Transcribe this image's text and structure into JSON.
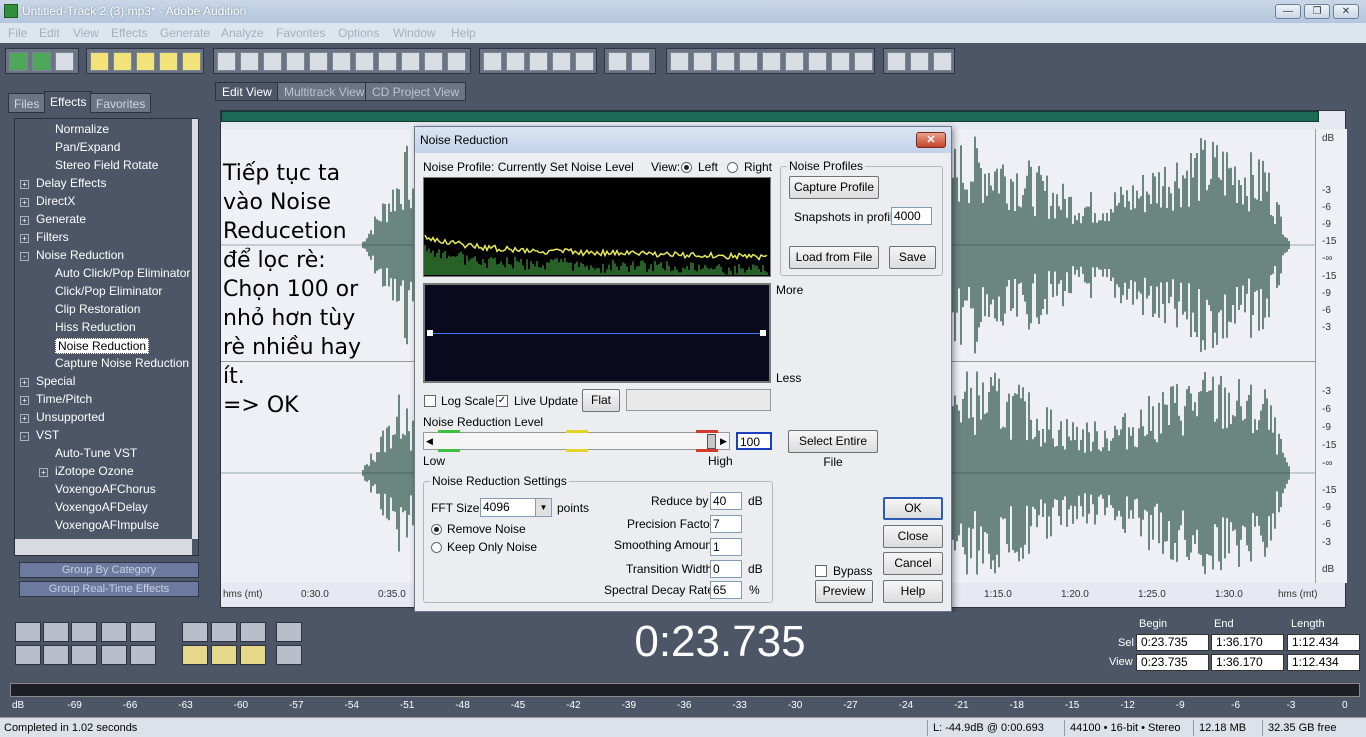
{
  "window": {
    "title": "Untitled-Track 2 (3).mp3* - Adobe Audition"
  },
  "menu": [
    "File",
    "Edit",
    "View",
    "Effects",
    "Generate",
    "Analyze",
    "Favorites",
    "Options",
    "Window",
    "Help"
  ],
  "left_panel": {
    "tabs": [
      "Files",
      "Effects",
      "Favorites"
    ],
    "tree": [
      {
        "label": "Normalize",
        "indent": 2
      },
      {
        "label": "Pan/Expand",
        "indent": 2
      },
      {
        "label": "Stereo Field Rotate",
        "indent": 2
      },
      {
        "label": "Delay Effects",
        "indent": 1,
        "toggle": "+"
      },
      {
        "label": "DirectX",
        "indent": 1,
        "toggle": "+"
      },
      {
        "label": "Generate",
        "indent": 1,
        "toggle": "+"
      },
      {
        "label": "Filters",
        "indent": 1,
        "toggle": "+"
      },
      {
        "label": "Noise Reduction",
        "indent": 1,
        "toggle": "-"
      },
      {
        "label": "Auto Click/Pop Eliminator",
        "indent": 2
      },
      {
        "label": "Click/Pop Eliminator",
        "indent": 2
      },
      {
        "label": "Clip Restoration",
        "indent": 2
      },
      {
        "label": "Hiss Reduction",
        "indent": 2
      },
      {
        "label": "Noise Reduction",
        "indent": 2,
        "selected": true
      },
      {
        "label": "Capture Noise Reduction Profile",
        "indent": 2
      },
      {
        "label": "Special",
        "indent": 1,
        "toggle": "+"
      },
      {
        "label": "Time/Pitch",
        "indent": 1,
        "toggle": "+"
      },
      {
        "label": "Unsupported",
        "indent": 1,
        "toggle": "+"
      },
      {
        "label": "VST",
        "indent": 1,
        "toggle": "-"
      },
      {
        "label": "Auto-Tune VST",
        "indent": 2
      },
      {
        "label": "iZotope Ozone",
        "indent": 2,
        "toggle": "+"
      },
      {
        "label": "VoxengoAFChorus",
        "indent": 2
      },
      {
        "label": "VoxengoAFDelay",
        "indent": 2
      },
      {
        "label": "VoxengoAFImpulse",
        "indent": 2
      }
    ],
    "group_by_category": "Group By Category",
    "group_realtime": "Group Real-Time Effects"
  },
  "view_tabs": [
    "Edit View",
    "Multitrack View",
    "CD Project View"
  ],
  "annotation": "Tiếp tục ta vào Noise Reducetion để lọc rè: Chọn 100 or nhỏ hơn tùy rè nhiều hay ít.\n=> OK",
  "db_scale_top": [
    "dB",
    "-3",
    "-6",
    "-9",
    "-15",
    "-∞",
    "-15",
    "-9",
    "-6",
    "-3"
  ],
  "db_scale_bottom": [
    "-3",
    "-6",
    "-9",
    "-15",
    "-∞",
    "-15",
    "-9",
    "-6",
    "-3",
    "dB"
  ],
  "timeline": [
    "hms (mt)",
    "0:30.0",
    "0:35.0",
    "1:15.0",
    "1:20.0",
    "1:25.0",
    "1:30.0",
    "hms (mt)"
  ],
  "dialog": {
    "title": "Noise Reduction",
    "close_glyph": "✕",
    "profile_label": "Noise Profile: Currently Set Noise Level",
    "view_label": "View:",
    "view_left": "Left",
    "view_right": "Right",
    "more": "More",
    "less": "Less",
    "log_scale": "Log Scale",
    "live_update": "Live Update",
    "flat": "Flat",
    "level_label": "Noise Reduction Level",
    "level_value": "100",
    "low": "Low",
    "high": "High",
    "select_entire_file": "Select Entire File",
    "profiles_group": "Noise Profiles",
    "capture_profile": "Capture Profile",
    "snapshots_label": "Snapshots in profile",
    "snapshots_value": "4000",
    "load_from_file": "Load from File",
    "save": "Save",
    "settings_group": "Noise Reduction Settings",
    "fft_label": "FFT Size",
    "fft_value": "4096",
    "points": "points",
    "remove_noise": "Remove Noise",
    "keep_only_noise": "Keep Only Noise",
    "reduce_by_label": "Reduce by",
    "reduce_by_value": "40",
    "db": "dB",
    "precision_label": "Precision Factor",
    "precision_value": "7",
    "smoothing_label": "Smoothing Amount",
    "smoothing_value": "1",
    "transition_label": "Transition Width",
    "transition_value": "0",
    "decay_label": "Spectral Decay Rate",
    "decay_value": "65",
    "percent": "%",
    "bypass": "Bypass",
    "ok": "OK",
    "close": "Close",
    "cancel": "Cancel",
    "preview": "Preview",
    "help": "Help"
  },
  "transport": {
    "time": "0:23.735",
    "headers": [
      "Begin",
      "End",
      "Length"
    ],
    "sel_label": "Sel",
    "view_label": "View",
    "sel": [
      "0:23.735",
      "1:36.170",
      "1:12.434"
    ],
    "view": [
      "0:23.735",
      "1:36.170",
      "1:12.434"
    ]
  },
  "level_scale": [
    "dB",
    "-69",
    "-66",
    "-63",
    "-60",
    "-57",
    "-54",
    "-51",
    "-48",
    "-45",
    "-42",
    "-39",
    "-36",
    "-33",
    "-30",
    "-27",
    "-24",
    "-21",
    "-18",
    "-15",
    "-12",
    "-9",
    "-6",
    "-3",
    "0"
  ],
  "status": {
    "message": "Completed in 1.02 seconds",
    "level": "L: -44.9dB @  0:00.693",
    "format": "44100 • 16-bit • Stereo",
    "size": "12.18 MB",
    "free": "32.35 GB free"
  },
  "colors": {
    "background": "#4c5667",
    "waveform": "#143f2e",
    "spectrum_noise": "#e8e85a",
    "spectrum_green": "#4fc24f",
    "default_button_border": "#2e5ab0"
  }
}
